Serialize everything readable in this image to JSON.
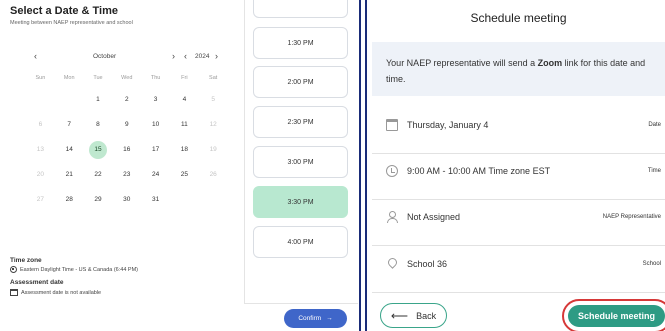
{
  "left": {
    "title": "Select a Date & Time",
    "subtitle": "Meeting between NAEP representative and school",
    "calendar": {
      "prev_month": "‹",
      "month": "October",
      "next_month": "›",
      "prev_year": "‹",
      "year": "2024",
      "next_year": "›",
      "weekdays": [
        "Sun",
        "Mon",
        "Tue",
        "Wed",
        "Thu",
        "Fri",
        "Sat"
      ],
      "weeks": [
        [
          {
            "d": "",
            "m": false
          },
          {
            "d": "",
            "m": false
          },
          {
            "d": "1",
            "m": false
          },
          {
            "d": "2",
            "m": false
          },
          {
            "d": "3",
            "m": false
          },
          {
            "d": "4",
            "m": false
          },
          {
            "d": "5",
            "m": true
          }
        ],
        [
          {
            "d": "6",
            "m": true
          },
          {
            "d": "7",
            "m": false
          },
          {
            "d": "8",
            "m": false
          },
          {
            "d": "9",
            "m": false
          },
          {
            "d": "10",
            "m": false
          },
          {
            "d": "11",
            "m": false
          },
          {
            "d": "12",
            "m": true
          }
        ],
        [
          {
            "d": "13",
            "m": true
          },
          {
            "d": "14",
            "m": false
          },
          {
            "d": "15",
            "m": false,
            "s": true
          },
          {
            "d": "16",
            "m": false
          },
          {
            "d": "17",
            "m": false
          },
          {
            "d": "18",
            "m": false
          },
          {
            "d": "19",
            "m": true
          }
        ],
        [
          {
            "d": "20",
            "m": true
          },
          {
            "d": "21",
            "m": false
          },
          {
            "d": "22",
            "m": false
          },
          {
            "d": "23",
            "m": false
          },
          {
            "d": "24",
            "m": false
          },
          {
            "d": "25",
            "m": false
          },
          {
            "d": "26",
            "m": true
          }
        ],
        [
          {
            "d": "27",
            "m": true
          },
          {
            "d": "28",
            "m": false
          },
          {
            "d": "29",
            "m": false
          },
          {
            "d": "30",
            "m": false
          },
          {
            "d": "31",
            "m": false
          },
          {
            "d": "",
            "m": false
          },
          {
            "d": "",
            "m": false
          }
        ]
      ]
    },
    "timezone_label": "Time zone",
    "timezone_value": "Eastern Daylight Time - US & Canada (6:44 PM)",
    "assessment_label": "Assessment date",
    "assessment_value": "Assessment date is not available",
    "slots": [
      "1:30 PM",
      "2:00 PM",
      "2:30 PM",
      "3:00 PM",
      "3:30 PM",
      "4:00 PM"
    ],
    "active_slot": "3:30 PM",
    "confirm_label": "Confirm",
    "confirm_arrow": "→"
  },
  "right": {
    "title": "Schedule meeting",
    "info_pre": "Your NAEP representative will send a ",
    "info_bold": "Zoom",
    "info_post": " link for this date and time.",
    "rows": [
      {
        "icon": "calendar-icon",
        "text": "Thursday, January 4",
        "tag": "Date"
      },
      {
        "icon": "clock-icon",
        "text": "9:00 AM - 10:00 AM Time zone EST",
        "tag": "Time"
      },
      {
        "icon": "user-icon",
        "text": "Not Assigned",
        "tag": "NAEP Representative"
      },
      {
        "icon": "location-pin-icon",
        "text": "School 36",
        "tag": "School"
      }
    ],
    "back_label": "Back",
    "back_arrow": "⟵",
    "schedule_label": "Schedule meeting"
  },
  "colors": {
    "accent_green": "#2e9b84",
    "selected_slot": "#b8e8d0",
    "confirm_blue": "#3f66c9",
    "separator": "#1a2c78",
    "highlight_ring": "#d63838"
  }
}
